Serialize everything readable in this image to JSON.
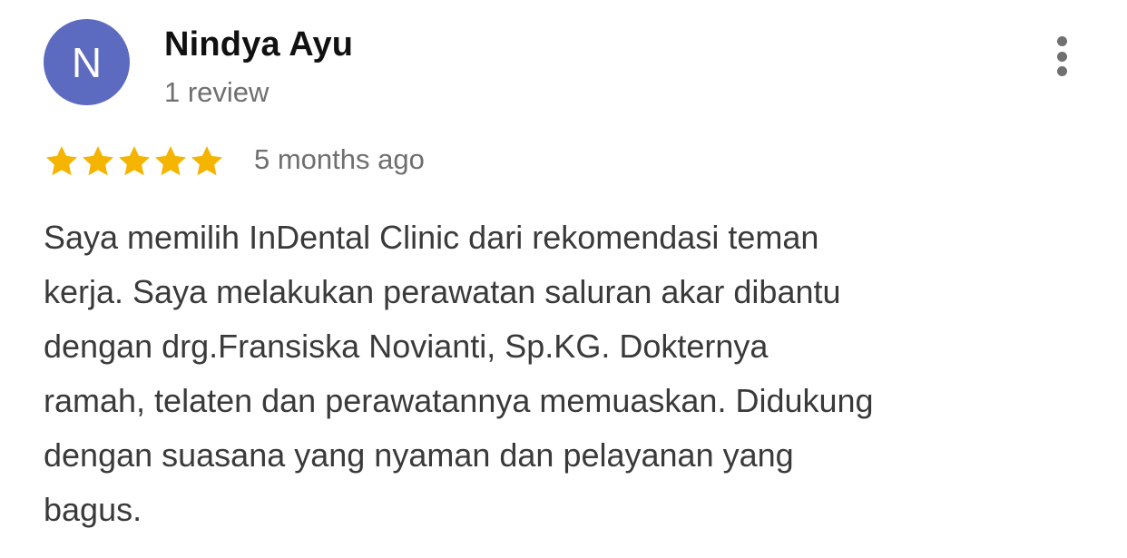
{
  "reviewer": {
    "avatar_initial": "N",
    "avatar_color": "#5c6bc0",
    "name": "Nindya Ayu",
    "review_count": "1 review"
  },
  "menu": {
    "icon": "more-vert-icon"
  },
  "review": {
    "rating": 5,
    "max_rating": 5,
    "star_color": "#f4b400",
    "time_ago": "5 months ago",
    "text_lines": [
      "Saya memilih InDental Clinic dari rekomendasi teman",
      "kerja. Saya melakukan perawatan saluran akar dibantu",
      "dengan drg.Fransiska Novianti, Sp.KG. Dokternya",
      "ramah, telaten dan perawatannya memuaskan. Didukung",
      "dengan suasana yang nyaman dan pelayanan yang",
      "bagus."
    ]
  }
}
